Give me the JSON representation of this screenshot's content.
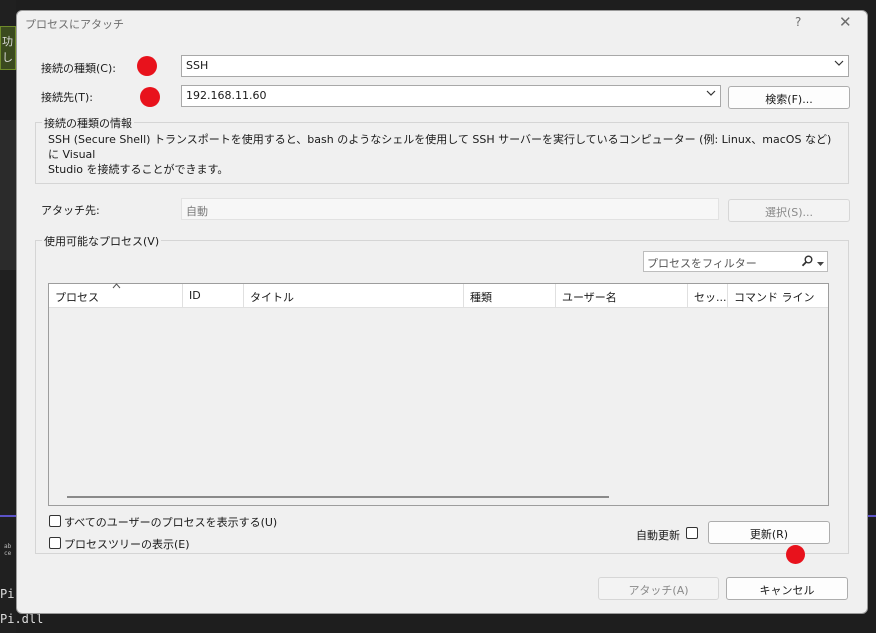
{
  "background": {
    "code_line_1": "Pi.",
    "code_line_2": "Pi.dll",
    "edge_fragment": "功し"
  },
  "dialog": {
    "title": "プロセスにアタッチ",
    "help_icon": "?",
    "close_icon": "✕"
  },
  "connection": {
    "type_label": "接続の種類(C):",
    "type_value": "SSH",
    "target_label": "接続先(T):",
    "target_value": "192.168.11.60",
    "find_button": "検索(F)..."
  },
  "info_group": {
    "title": "接続の種類の情報",
    "text_line_1": "SSH (Secure Shell) トランスポートを使用すると、bash のようなシェルを使用して SSH サーバーを実行しているコンピューター (例: Linux、macOS など) に Visual",
    "text_line_2": "Studio を接続することができます。"
  },
  "attach_to": {
    "label": "アタッチ先:",
    "value": "自動",
    "select_button": "選択(S)..."
  },
  "processes": {
    "group_title": "使用可能なプロセス(V)",
    "filter_placeholder": "プロセスをフィルター",
    "columns": [
      "プロセス",
      "ID",
      "タイトル",
      "種類",
      "ユーザー名",
      "セッ...",
      "コマンド ライン"
    ],
    "sort_indicator": "^",
    "show_all_users": "すべてのユーザーのプロセスを表示する(U)",
    "show_tree": "プロセスツリーの表示(E)",
    "auto_refresh": "自動更新",
    "refresh_button": "更新(R)"
  },
  "footer": {
    "attach_button": "アタッチ(A)",
    "cancel_button": "キャンセル"
  },
  "colors": {
    "annotation_dot": "#e8121c",
    "dialog_bg": "#f0f0f0"
  }
}
